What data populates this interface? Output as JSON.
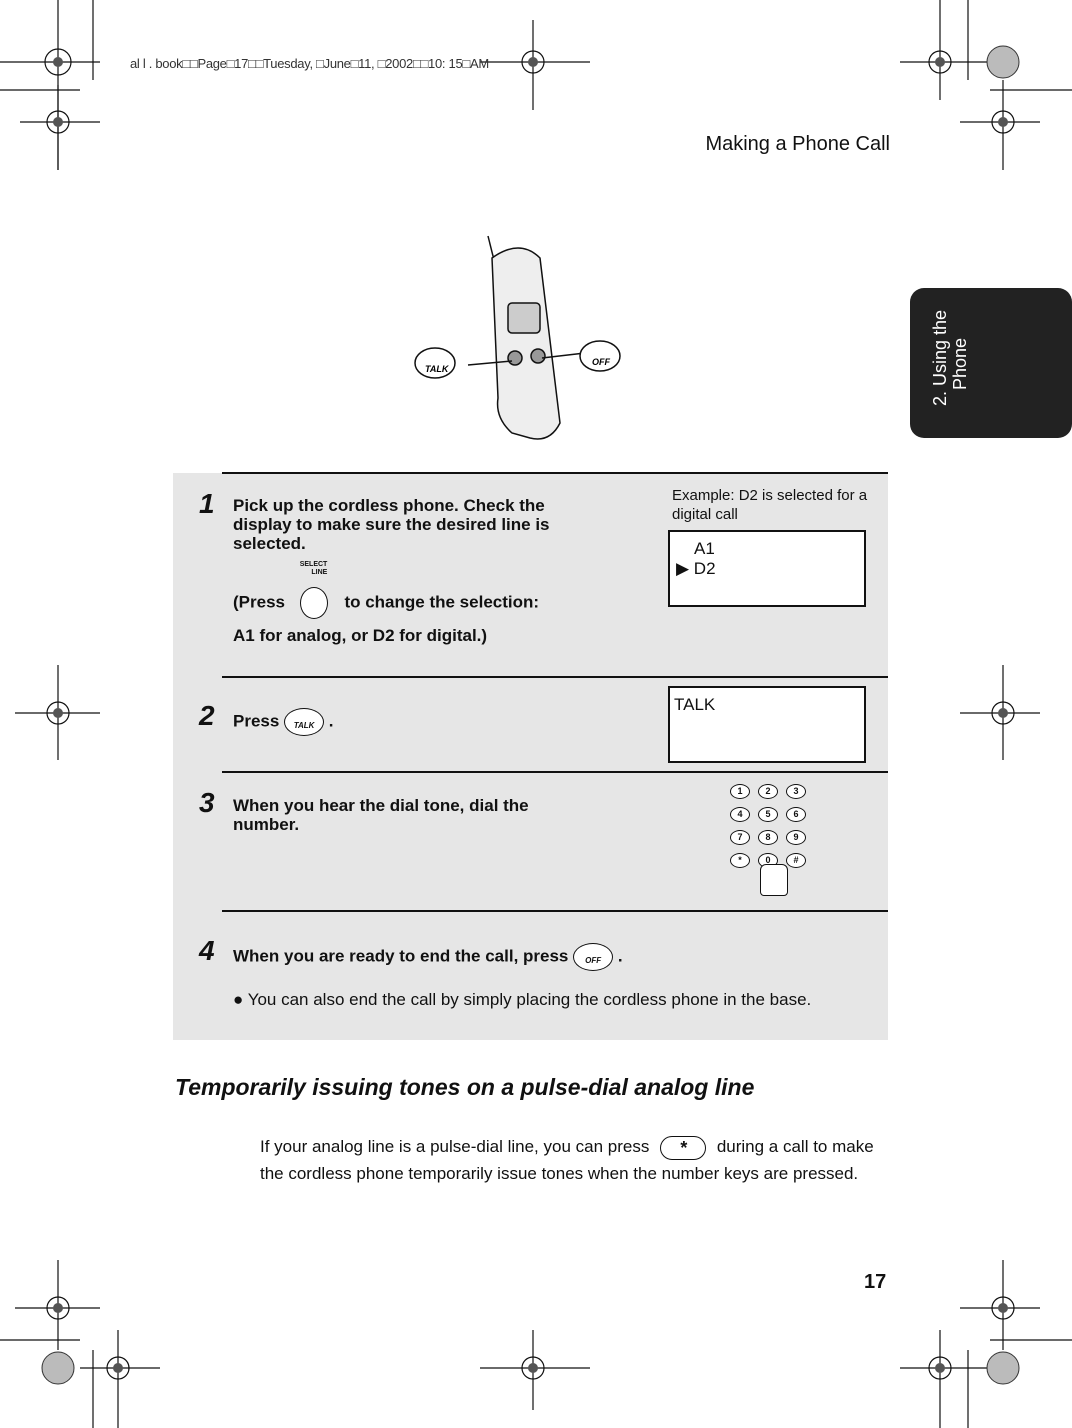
{
  "meta_line": "al l . book□□Page□17□□Tuesday, □June□11, □2002□□10: 15□AM",
  "header": "Making a Phone Call",
  "side_tab": {
    "line1": "2. Using the",
    "line2": "Phone"
  },
  "illustration": {
    "talk_label": "TALK",
    "off_label": "OFF"
  },
  "steps": [
    {
      "number": "1",
      "text": "Pick up the cordless phone. Check the display to make sure the desired line is selected.",
      "press_prefix": "(Press",
      "button_label_top": "SELECT",
      "button_label_bottom": "LINE",
      "press_suffix": "to change the selection:",
      "note": "A1 for analog, or D2 for digital.)"
    },
    {
      "number": "2",
      "prefix": "Press",
      "button": "TALK",
      "suffix": "."
    },
    {
      "number": "3",
      "text": "When you hear the dial tone, dial the number."
    },
    {
      "number": "4",
      "prefix": "When you are ready to end the call, press",
      "button": "OFF",
      "suffix": ".",
      "bullet": "You can also end the call by simply placing the cordless phone in the base."
    }
  ],
  "example": {
    "caption": "Example: D2 is selected for a digital call",
    "line1": "A1",
    "line2": "▶ D2"
  },
  "display2": "TALK",
  "keypad": [
    "1",
    "2",
    "3",
    "4",
    "5",
    "6",
    "7",
    "8",
    "9",
    "*",
    "0",
    "#"
  ],
  "section": {
    "title": "Temporarily issuing tones on a pulse-dial analog line",
    "para_before": "If your analog line is a pulse-dial line, you can press",
    "key": "*",
    "para_after": "during a call to make the cordless phone temporarily issue tones when the number keys are pressed."
  },
  "page_number": "17"
}
